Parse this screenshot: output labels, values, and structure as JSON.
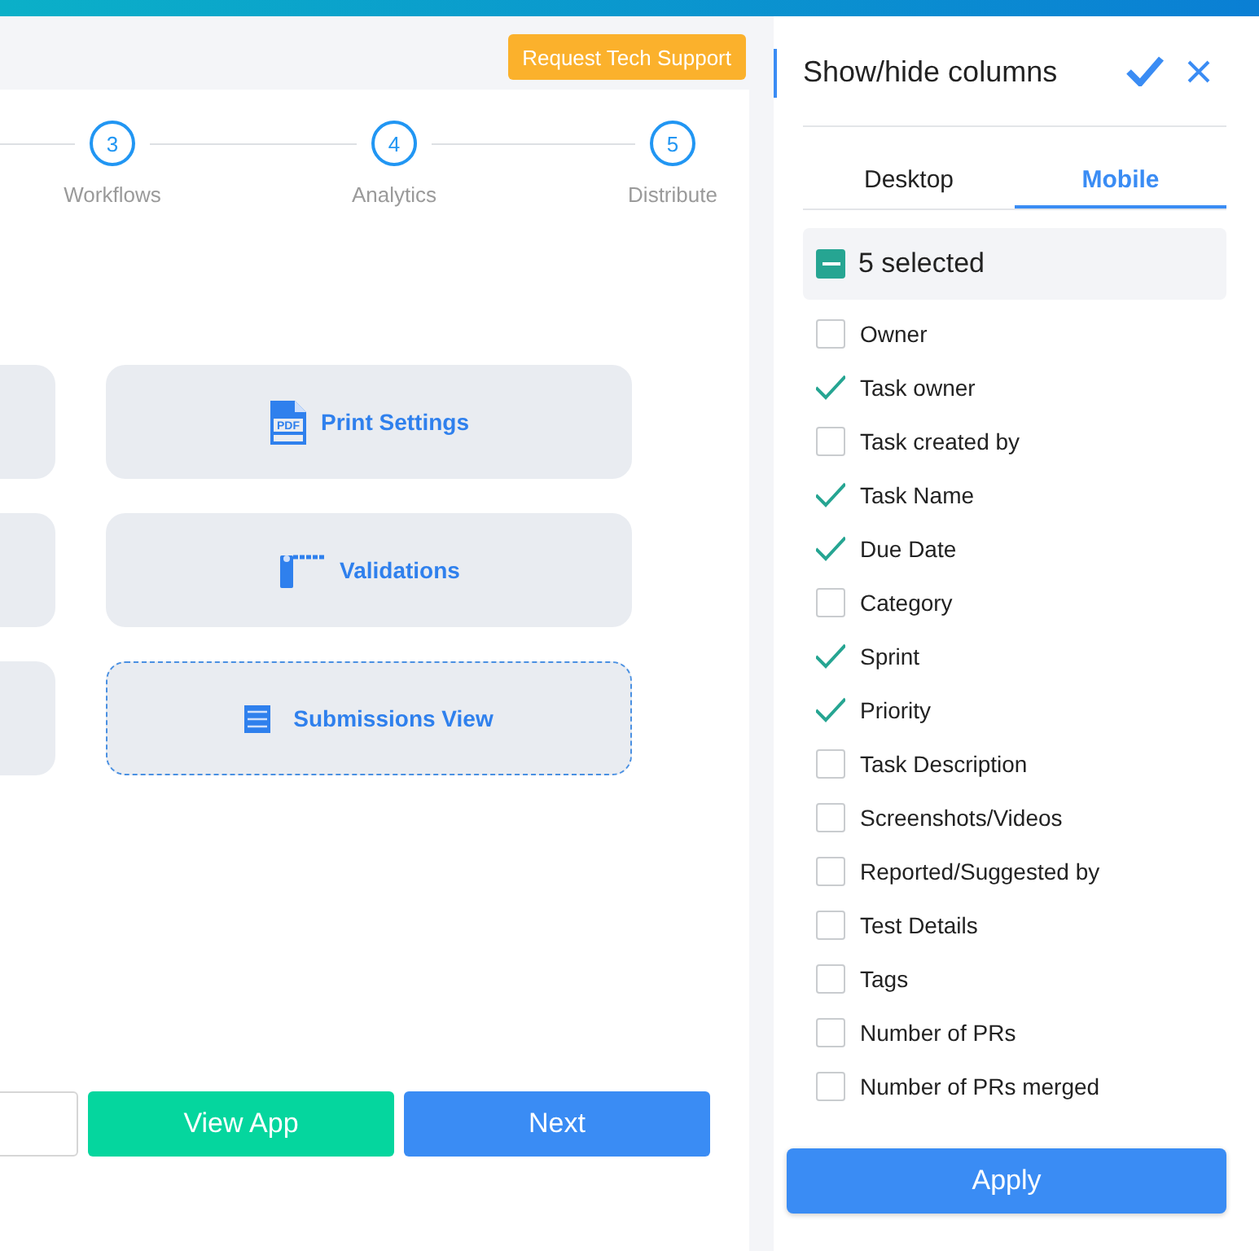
{
  "header": {
    "support_button": "Request Tech Support"
  },
  "steps": [
    {
      "number": "3",
      "label": "Workflows"
    },
    {
      "number": "4",
      "label": "Analytics"
    },
    {
      "number": "5",
      "label": "Distribute"
    }
  ],
  "cards": [
    {
      "label": "Print Settings",
      "kind": "pdf",
      "icon_text": "PDF",
      "dashed": false
    },
    {
      "label": "Validations",
      "kind": "barrier",
      "dashed": false
    },
    {
      "label": "Submissions View",
      "kind": "list",
      "dashed": true
    }
  ],
  "footer_buttons": [
    {
      "label": "View App",
      "kind": "green"
    },
    {
      "label": "Next",
      "kind": "blue"
    }
  ],
  "panel": {
    "title": "Show/hide columns",
    "tabs": [
      {
        "label": "Desktop",
        "selected": false
      },
      {
        "label": "Mobile",
        "selected": true
      }
    ],
    "select_all": {
      "label": "5 selected",
      "partial": true
    },
    "columns": [
      {
        "label": "Owner",
        "checked": false
      },
      {
        "label": "Task owner",
        "checked": true
      },
      {
        "label": "Task created by",
        "checked": false
      },
      {
        "label": "Task Name",
        "checked": true
      },
      {
        "label": "Due Date",
        "checked": true
      },
      {
        "label": "Category",
        "checked": false
      },
      {
        "label": "Sprint",
        "checked": true
      },
      {
        "label": "Priority",
        "checked": true
      },
      {
        "label": "Task Description",
        "checked": false
      },
      {
        "label": "Screenshots/Videos",
        "checked": false
      },
      {
        "label": "Reported/Suggested by",
        "checked": false
      },
      {
        "label": "Test Details",
        "checked": false
      },
      {
        "label": "Tags",
        "checked": false
      },
      {
        "label": "Number of PRs",
        "checked": false
      },
      {
        "label": "Number of PRs merged",
        "checked": false
      }
    ],
    "apply_button": "Apply"
  }
}
